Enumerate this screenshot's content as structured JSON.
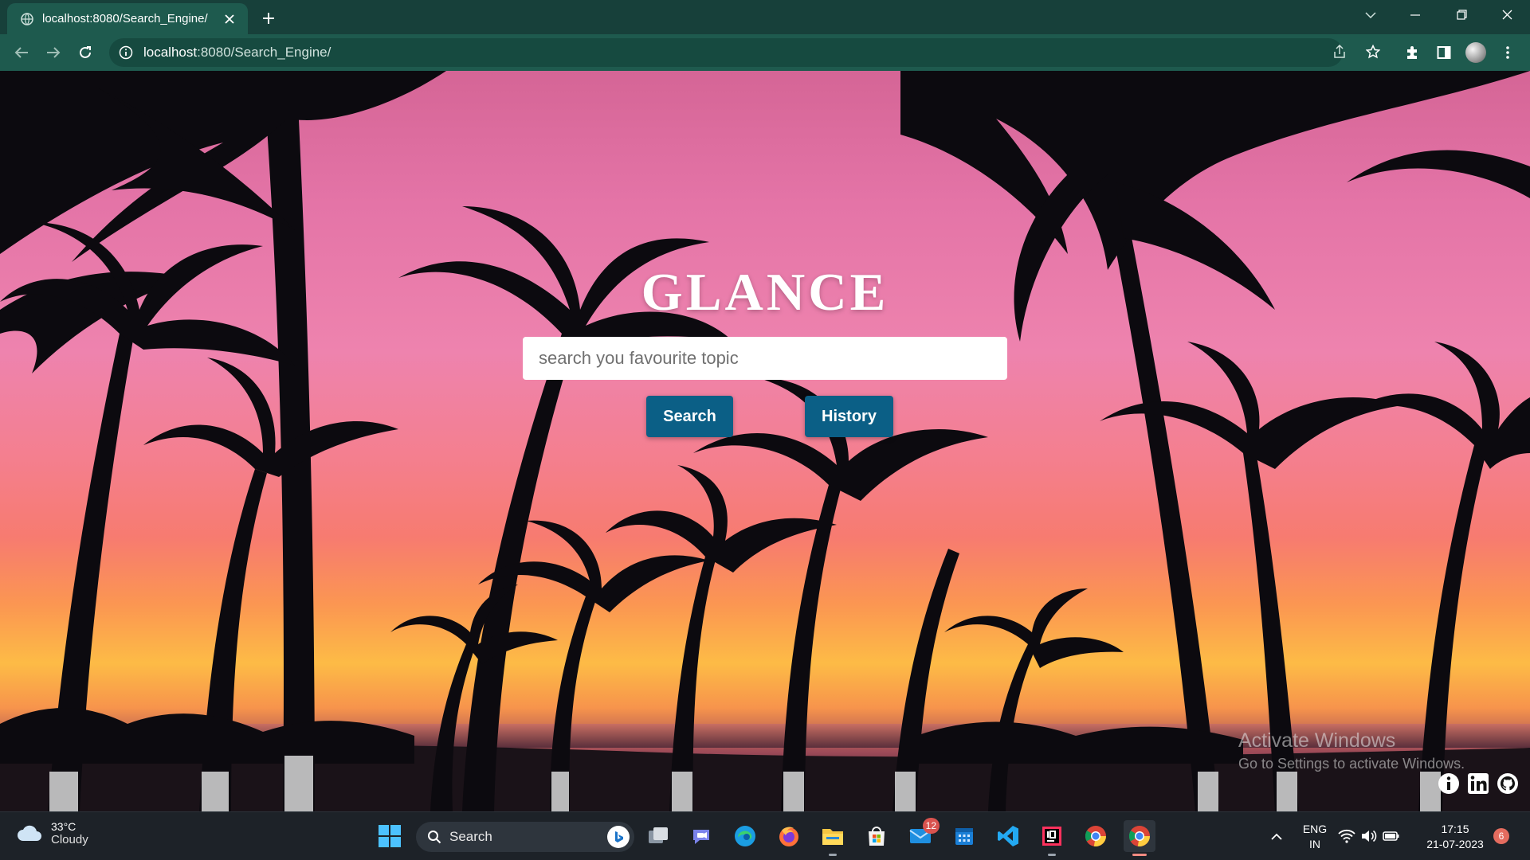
{
  "browser": {
    "tab": {
      "title": "localhost:8080/Search_Engine/"
    },
    "url": {
      "host": "localhost",
      "rest": ":8080/Search_Engine/"
    }
  },
  "page": {
    "brand": "GLANCE",
    "search_placeholder": "search you favourite topic",
    "search_button": "Search",
    "history_button": "History",
    "watermark": {
      "line1": "Activate Windows",
      "line2": "Go to Settings to activate Windows."
    }
  },
  "taskbar": {
    "weather": {
      "temp": "33°C",
      "condition": "Cloudy"
    },
    "search_label": "Search",
    "mail_badge": "12",
    "lang": {
      "line1": "ENG",
      "line2": "IN"
    },
    "clock": {
      "time": "17:15",
      "date": "21-07-2023"
    },
    "notifications": "6"
  },
  "colors": {
    "chrome_dark": "#17403a",
    "chrome": "#1e5a4e",
    "button": "#0b5f86",
    "taskbar": "#1d2228"
  }
}
